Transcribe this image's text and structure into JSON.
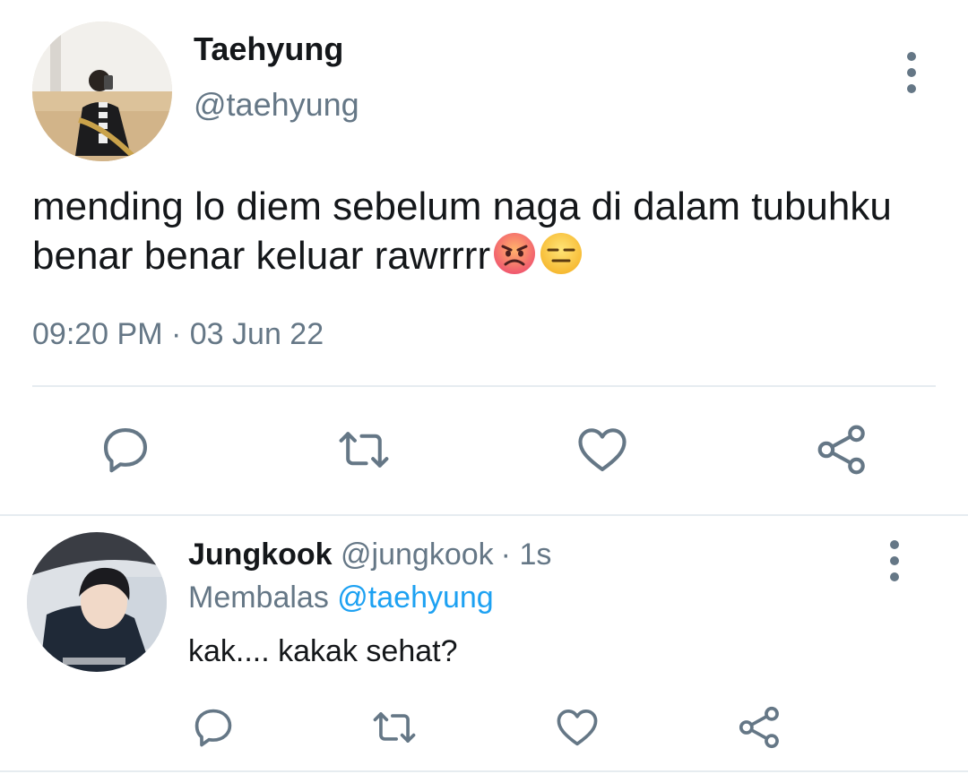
{
  "main_tweet": {
    "display_name": "Taehyung",
    "handle": "@taehyung",
    "text": "mending lo diem sebelum naga di dalam tubuhku benar benar keluar rawrrrr",
    "emojis": [
      "angry-face-emoji",
      "expressionless-face-emoji"
    ],
    "time": "09:20 PM",
    "separator": "·",
    "date": "03 Jun 22"
  },
  "reply_tweet": {
    "display_name": "Jungkook",
    "handle": "@jungkook",
    "separator": "·",
    "age": "1s",
    "replying_prefix": "Membalas",
    "replying_to": "@taehyung",
    "text": "kak.... kakak sehat?"
  },
  "actions": [
    "reply-icon",
    "retweet-icon",
    "like-icon",
    "share-icon"
  ],
  "colors": {
    "text": "#14171a",
    "secondary": "#657786",
    "link": "#1da1f2",
    "divider": "#e6ecf0"
  }
}
